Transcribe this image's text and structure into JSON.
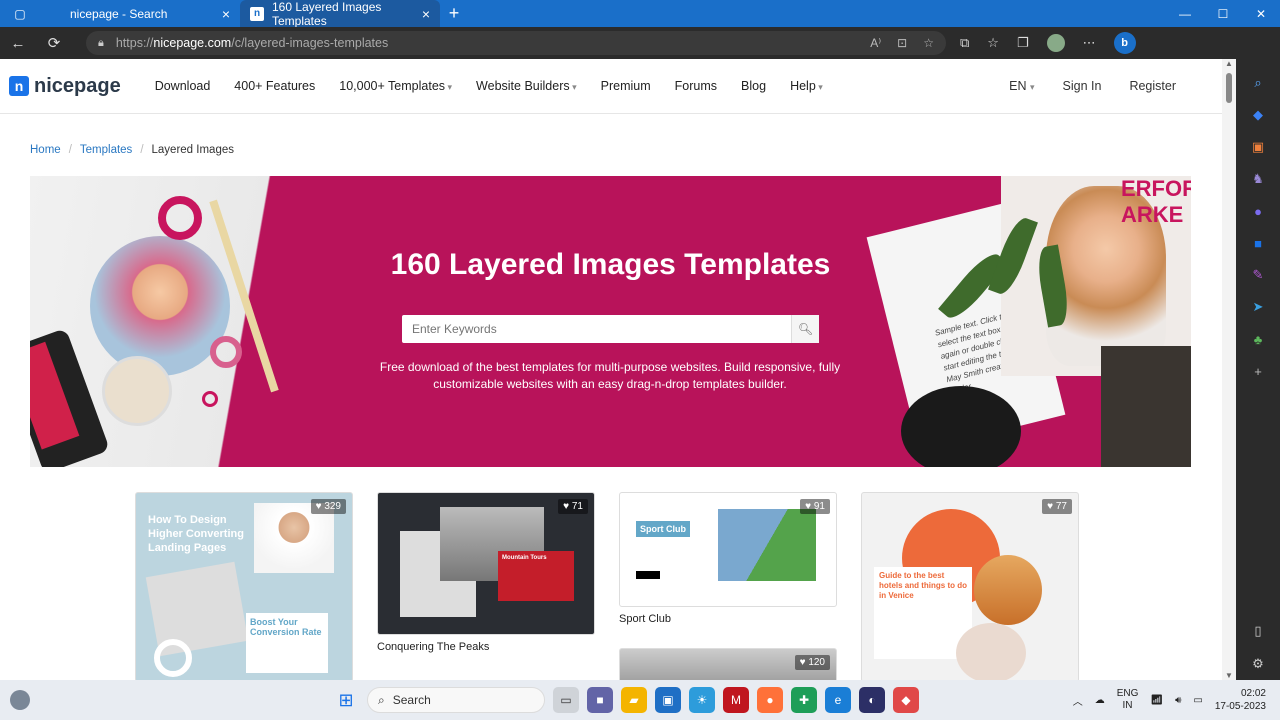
{
  "browser": {
    "tabs": [
      {
        "label": "nicepage - Search",
        "active": false
      },
      {
        "label": "160 Layered Images Templates",
        "active": true
      }
    ],
    "favicon_letter": "n",
    "new_tab": "+",
    "window_controls": {
      "minimize": "—",
      "maximize": "☐",
      "close": "✕"
    },
    "url_prefix": "https://",
    "url_domain": "nicepage.com",
    "url_path": "/c/layered-images-templates",
    "read_aloud": "A⁾"
  },
  "header": {
    "logo_letter": "n",
    "logo_text": "nicepage",
    "menu": [
      "Download",
      "400+ Features",
      "10,000+ Templates",
      "Website Builders",
      "Premium",
      "Forums",
      "Blog",
      "Help"
    ],
    "language": "EN",
    "sign_in": "Sign In",
    "register": "Register"
  },
  "breadcrumb": {
    "home": "Home",
    "templates": "Templates",
    "current": "Layered Images",
    "separator": "/"
  },
  "hero": {
    "title": "160 Layered Images Templates",
    "search_placeholder": "Enter Keywords",
    "description": "Free download of the best templates for multi-purpose websites. Build responsive, fully customizable websites with an easy drag-n-drop templates builder.",
    "corner_text": "ERFOR\nARKE",
    "note_text": "Sample text. Click to select the text box. Click again or double click to start editing the text. - May Smith creative leader"
  },
  "cards": [
    {
      "likes": "329",
      "title": "",
      "thumb_heading": "How To Design Higher Converting Landing Pages",
      "thumb_sub": "Boost Your Conversion Rate"
    },
    {
      "likes": "71",
      "title": "Conquering The Peaks",
      "thumb_heading": "Mountain Tours"
    },
    {
      "likes": "91",
      "title": "Sport Club",
      "thumb_heading": "Sport Club"
    },
    {
      "likes": "77",
      "title": "",
      "thumb_heading": "Guide to the best hotels and things to do in Venice"
    },
    {
      "likes": "120",
      "title": ""
    }
  ],
  "taskbar": {
    "search_label": "Search",
    "lang_line1": "ENG",
    "lang_line2": "IN",
    "time": "02:02",
    "date": "17-05-2023"
  },
  "colors": {
    "hero_bg": "#b8135a",
    "tab_bar": "#1a6fc9",
    "link": "#2a78c2"
  }
}
